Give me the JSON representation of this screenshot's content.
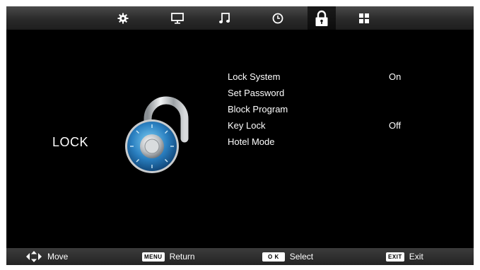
{
  "topbar": {
    "tabs": [
      {
        "icon": "settings-gear-icon"
      },
      {
        "icon": "monitor-icon"
      },
      {
        "icon": "music-note-icon"
      },
      {
        "icon": "clock-icon"
      },
      {
        "icon": "padlock-icon",
        "active": true
      },
      {
        "icon": "grid-icon"
      }
    ]
  },
  "main": {
    "title": "LOCK",
    "menu": [
      {
        "label": "Lock System",
        "value": "On"
      },
      {
        "label": "Set Password",
        "value": ""
      },
      {
        "label": "Block Program",
        "value": ""
      },
      {
        "label": "Key Lock",
        "value": "Off"
      },
      {
        "label": "Hotel Mode",
        "value": ""
      }
    ]
  },
  "bottombar": {
    "hints": [
      {
        "key": "",
        "icon": "directional-arrows-icon",
        "label": "Move"
      },
      {
        "key": "MENU",
        "label": "Return"
      },
      {
        "key": "O K",
        "label": "Select"
      },
      {
        "key": "EXIT",
        "label": "Exit"
      }
    ]
  },
  "colors": {
    "background": "#000000",
    "bar": "#2e2e2e",
    "text": "#ffffff",
    "lock_blue": "#2a7fc0"
  }
}
